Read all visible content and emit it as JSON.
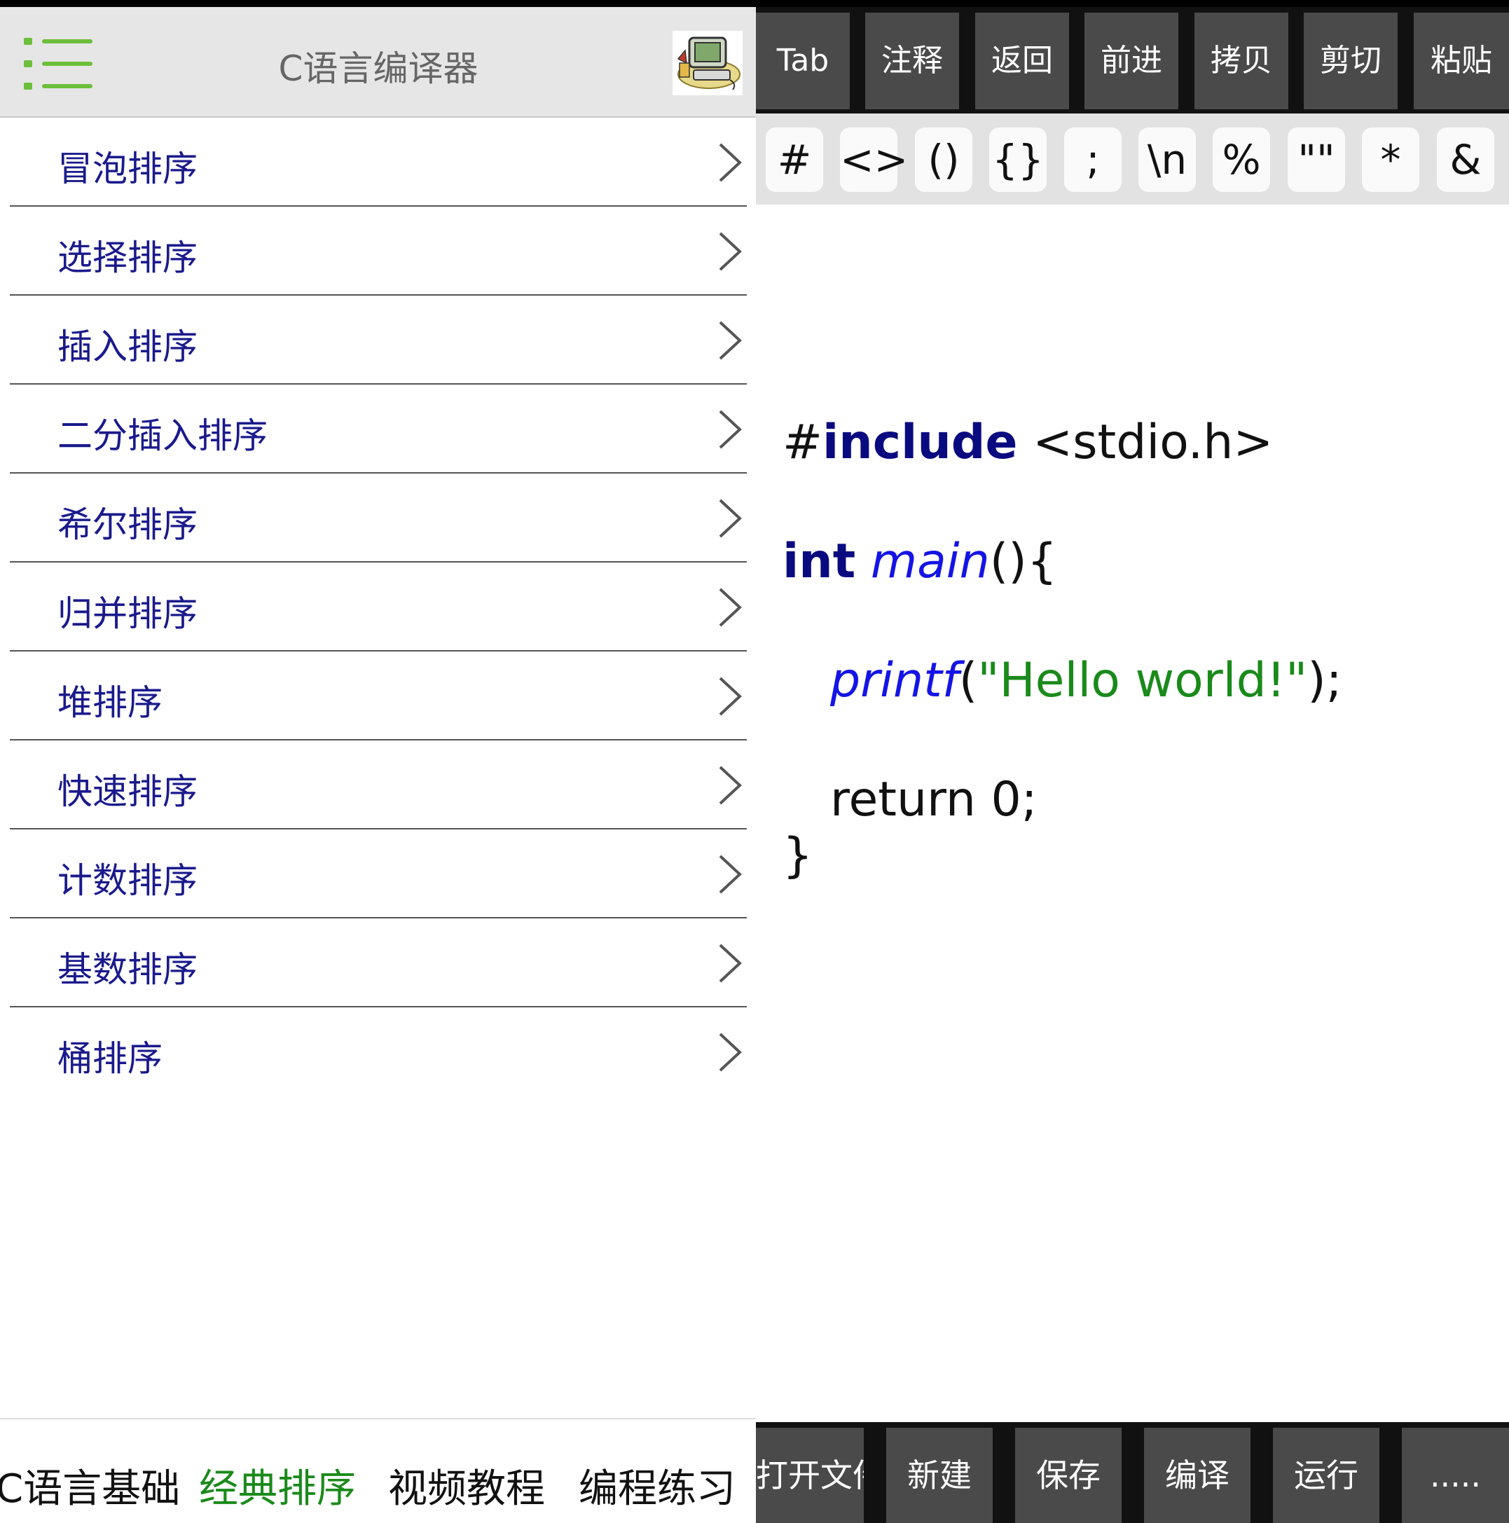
{
  "header": {
    "title": "C语言编译器",
    "menu_icon": "hamburger-menu-icon",
    "avatar_icon": "computer-clipart-icon"
  },
  "sort_list": {
    "items": [
      {
        "label": "冒泡排序"
      },
      {
        "label": "选择排序"
      },
      {
        "label": "插入排序"
      },
      {
        "label": "二分插入排序"
      },
      {
        "label": "希尔排序"
      },
      {
        "label": "归并排序"
      },
      {
        "label": "堆排序"
      },
      {
        "label": "快速排序"
      },
      {
        "label": "计数排序"
      },
      {
        "label": "基数排序"
      },
      {
        "label": "桶排序"
      }
    ]
  },
  "bottom_tabs": [
    {
      "label": "C语言基础",
      "active": false
    },
    {
      "label": "经典排序",
      "active": true
    },
    {
      "label": "视频教程",
      "active": false
    },
    {
      "label": "编程练习",
      "active": false
    }
  ],
  "editor_toolbar": {
    "row1": [
      "Tab",
      "注释",
      "返回",
      "前进",
      "拷贝",
      "剪切",
      "粘贴"
    ],
    "row2": [
      "#",
      "<>",
      "()",
      "{}",
      ";",
      "\\n",
      "%",
      "\"\"",
      "*",
      "&"
    ]
  },
  "code": {
    "include_hash": "#",
    "include_kw": "include",
    "include_rest": " <stdio.h>",
    "int_kw": "int",
    "main_fn": "main",
    "main_rest": "(){",
    "printf_fn": "printf",
    "printf_open": "(",
    "printf_str": "\"Hello world!\"",
    "printf_close": ");",
    "return_line": "return 0;",
    "close_brace": "}"
  },
  "action_bar": [
    "打开文件",
    "新建",
    "保存",
    "编译",
    "运行",
    "....."
  ],
  "colors": {
    "list_text": "#1a1a8c",
    "active_tab": "#1a8a1a",
    "menu_icon": "#6cbf3a",
    "keyword": "#0a0a80",
    "function": "#1414e6",
    "string": "#1a8a1a"
  }
}
